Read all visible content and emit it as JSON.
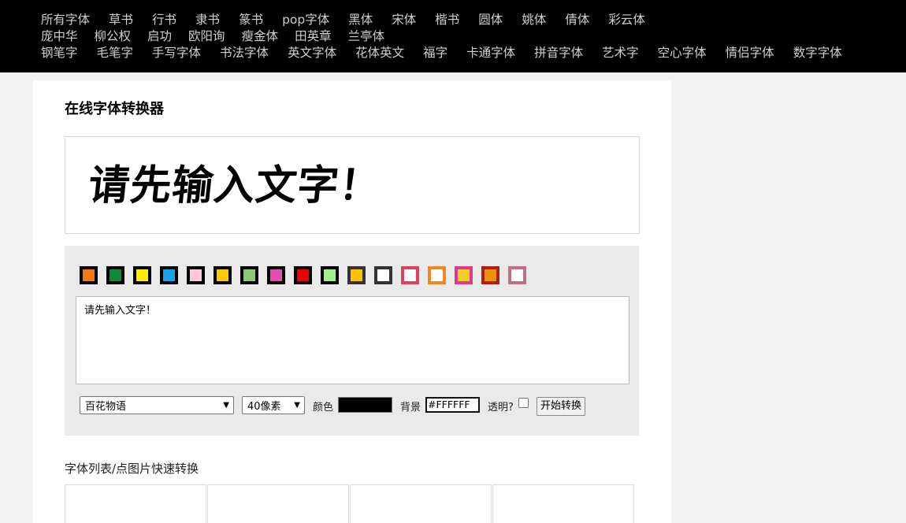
{
  "nav": {
    "row1": [
      "所有字体",
      "草书",
      "行书",
      "隶书",
      "篆书",
      "pop字体",
      "黑体",
      "宋体",
      "楷书",
      "圆体",
      "姚体",
      "倩体",
      "彩云体"
    ],
    "row2": [
      "庞中华",
      "柳公权",
      "启功",
      "欧阳询",
      "瘦金体",
      "田英章",
      "兰亭体"
    ],
    "row3": [
      "钢笔字",
      "毛笔字",
      "手写字体",
      "书法字体",
      "英文字体",
      "花体英文",
      "福字",
      "卡通字体",
      "拼音字体",
      "艺术字",
      "空心字体",
      "情侣字体",
      "数字字体"
    ]
  },
  "page_title": "在线字体转换器",
  "preview_text": "请先输入文字！",
  "swatches": [
    {
      "fill": "#f07a10",
      "border": "#000000"
    },
    {
      "fill": "#0a8a3a",
      "border": "#000000"
    },
    {
      "fill": "#ffee00",
      "border": "#000000"
    },
    {
      "fill": "#1aa0e8",
      "border": "#000000"
    },
    {
      "fill": "#ffc8dc",
      "border": "#000000"
    },
    {
      "fill": "#ffc800",
      "border": "#000000"
    },
    {
      "fill": "#8cc870",
      "border": "#000000"
    },
    {
      "fill": "#e050b0",
      "border": "#000000"
    },
    {
      "fill": "#ee0000",
      "border": "#000000"
    },
    {
      "fill": "#a0f090",
      "border": "#000000"
    },
    {
      "fill": "#ffc000",
      "border": "#333333"
    },
    {
      "fill": "#ffffff",
      "border": "#333333"
    },
    {
      "fill": "#ffffff",
      "border": "#e04060"
    },
    {
      "fill": "#ffffff",
      "border": "#f08a20"
    },
    {
      "fill": "#f0d020",
      "border": "#e03a90"
    },
    {
      "fill": "#f09010",
      "border": "#b02010"
    },
    {
      "fill": "#ffffff",
      "border": "#c07080"
    }
  ],
  "input_text": "请先输入文字！",
  "controls": {
    "font_selected": "百花物语",
    "size_selected": "40像素",
    "color_label": "颜色",
    "color_value": "#000000",
    "bg_label": "背景",
    "bg_value": "#FFFFFF",
    "transparent_label": "透明?",
    "convert_label": "开始转换"
  },
  "list_title": "字体列表/点图片快速转换",
  "font_cells": 4
}
